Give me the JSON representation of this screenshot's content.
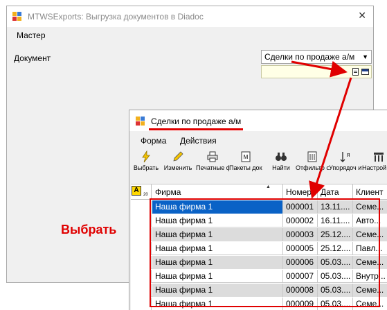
{
  "main_window": {
    "title": "MTWSExports: Выгрузка документов в Diadoc",
    "close_glyph": "✕",
    "menu": [
      "Мастер"
    ],
    "document_label": "Документ",
    "document_combo_value": "Сделки по продаже а/м"
  },
  "child_window": {
    "title": "Сделки по продаже а/м",
    "menu": [
      "Форма",
      "Действия"
    ],
    "toolbar": [
      {
        "label": "Выбрать",
        "icon": "lightning-icon"
      },
      {
        "label": "Изменить",
        "icon": "pencil-icon"
      },
      {
        "label": "Печатные формы",
        "icon": "printer-icon"
      },
      {
        "label": "Пакеты докумен…",
        "icon": "package-icon"
      },
      {
        "label": "Найти",
        "icon": "binoculars-icon"
      },
      {
        "label": "Отфильтр овать",
        "icon": "filter-icon"
      },
      {
        "label": "Упорядоч ить",
        "icon": "sort-icon"
      },
      {
        "label": "Настрой столбц",
        "icon": "columns-icon"
      }
    ],
    "grid": {
      "badge": "A",
      "version": "20",
      "columns": [
        "Фирма",
        "Номер",
        "Дата",
        "Клиент"
      ],
      "rows": [
        {
          "firm": "Наша фирма 1",
          "number": "000001",
          "date": "13.11....",
          "client": "Семе..."
        },
        {
          "firm": "Наша фирма 1",
          "number": "000002",
          "date": "16.11....",
          "client": "Авто..."
        },
        {
          "firm": "Наша фирма 1",
          "number": "000003",
          "date": "25.12....",
          "client": "Семе..."
        },
        {
          "firm": "Наша фирма 1",
          "number": "000005",
          "date": "25.12....",
          "client": "Павл..."
        },
        {
          "firm": "Наша фирма 1",
          "number": "000006",
          "date": "05.03....",
          "client": "Семе..."
        },
        {
          "firm": "Наша фирма 1",
          "number": "000007",
          "date": "05.03....",
          "client": "Внутр..."
        },
        {
          "firm": "Наша фирма 1",
          "number": "000008",
          "date": "05.03....",
          "client": "Семе..."
        },
        {
          "firm": "Наша фирма 1",
          "number": "000009",
          "date": "05.03....",
          "client": "Семе..."
        }
      ]
    }
  },
  "annotation": {
    "label": "Выбрать",
    "color": "#e00000"
  }
}
